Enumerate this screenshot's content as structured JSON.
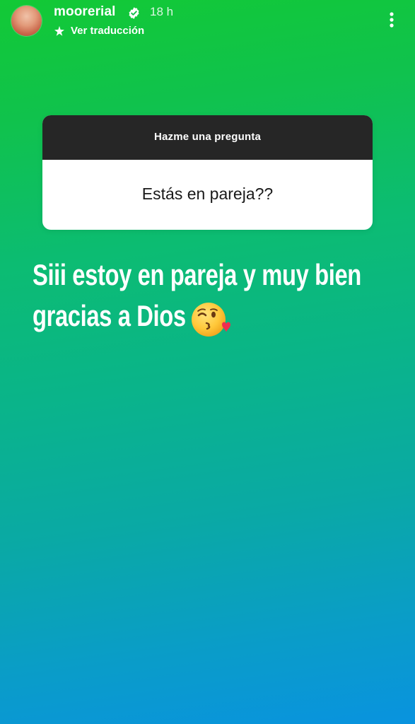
{
  "header": {
    "username": "moorerial",
    "time": "18 h",
    "translate_label": "Ver traducción",
    "icons": [
      "avatar",
      "verified-badge-icon",
      "translate-icon",
      "more-options-icon"
    ]
  },
  "question_sticker": {
    "title": "Hazme una pregunta",
    "question": "Estás en pareja??"
  },
  "answer": {
    "line1": "Siii estoy en pareja y muy bien",
    "line2": "gracias a Dios",
    "emoji": "face-blowing-a-kiss-icon"
  },
  "colors": {
    "gradient_top": "#12c935",
    "gradient_bottom": "#0993df",
    "sticker_header": "#262626",
    "sticker_body": "#ffffff"
  }
}
